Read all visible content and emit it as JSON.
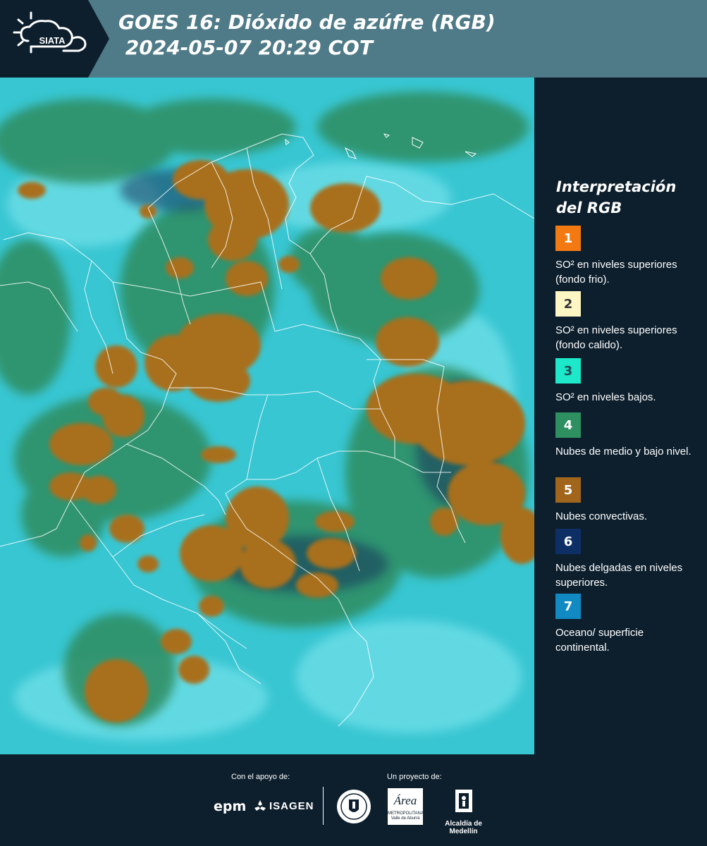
{
  "header": {
    "logo_text": "SIATA",
    "title": "GOES 16: Dióxido de azúfre (RGB)\n 2024-05-07 20:29 COT"
  },
  "legend": {
    "title": "Interpretación del RGB",
    "items": [
      {
        "number": "1",
        "label": "SO² en niveles superiores (fondo frio).",
        "color": "#f37a12",
        "number_color": "#ffffff"
      },
      {
        "number": "2",
        "label": "SO² en niveles superiores (fondo calido).",
        "color": "#fff6c4",
        "number_color": "#333333"
      },
      {
        "number": "3",
        "label": "SO² en niveles bajos.",
        "color": "#1de8c9",
        "number_color": "#1a4a55"
      },
      {
        "number": "4",
        "label": "Nubes de medio y bajo nivel.",
        "color": "#2e8f61",
        "number_color": "#ffffff"
      },
      {
        "number": "5",
        "label": "Nubes convectivas.",
        "color": "#a1661c",
        "number_color": "#ffffff"
      },
      {
        "number": "6",
        "label": "Nubes delgadas en niveles superiores.",
        "color": "#0e2f66",
        "number_color": "#ffffff"
      },
      {
        "number": "7",
        "label": "Oceano/ superficie continental.",
        "color": "#1189c2",
        "number_color": "#ffffff"
      }
    ]
  },
  "footer": {
    "support_label": "Con el apoyo de:",
    "project_label": "Un proyecto de:",
    "epm": "epm",
    "isagen": "ISAGEN",
    "area_logo": "Área",
    "area_sub": "METROPOLITANA Valle de Aburrá",
    "alcaldia": "Alcaldía de Medellín"
  },
  "colors": {
    "header_bg": "#4f7a87",
    "panel_bg": "#0d1f2d",
    "ocean": "#35c9d4",
    "convective": "#a1661c",
    "low_clouds": "#2e8f61"
  }
}
